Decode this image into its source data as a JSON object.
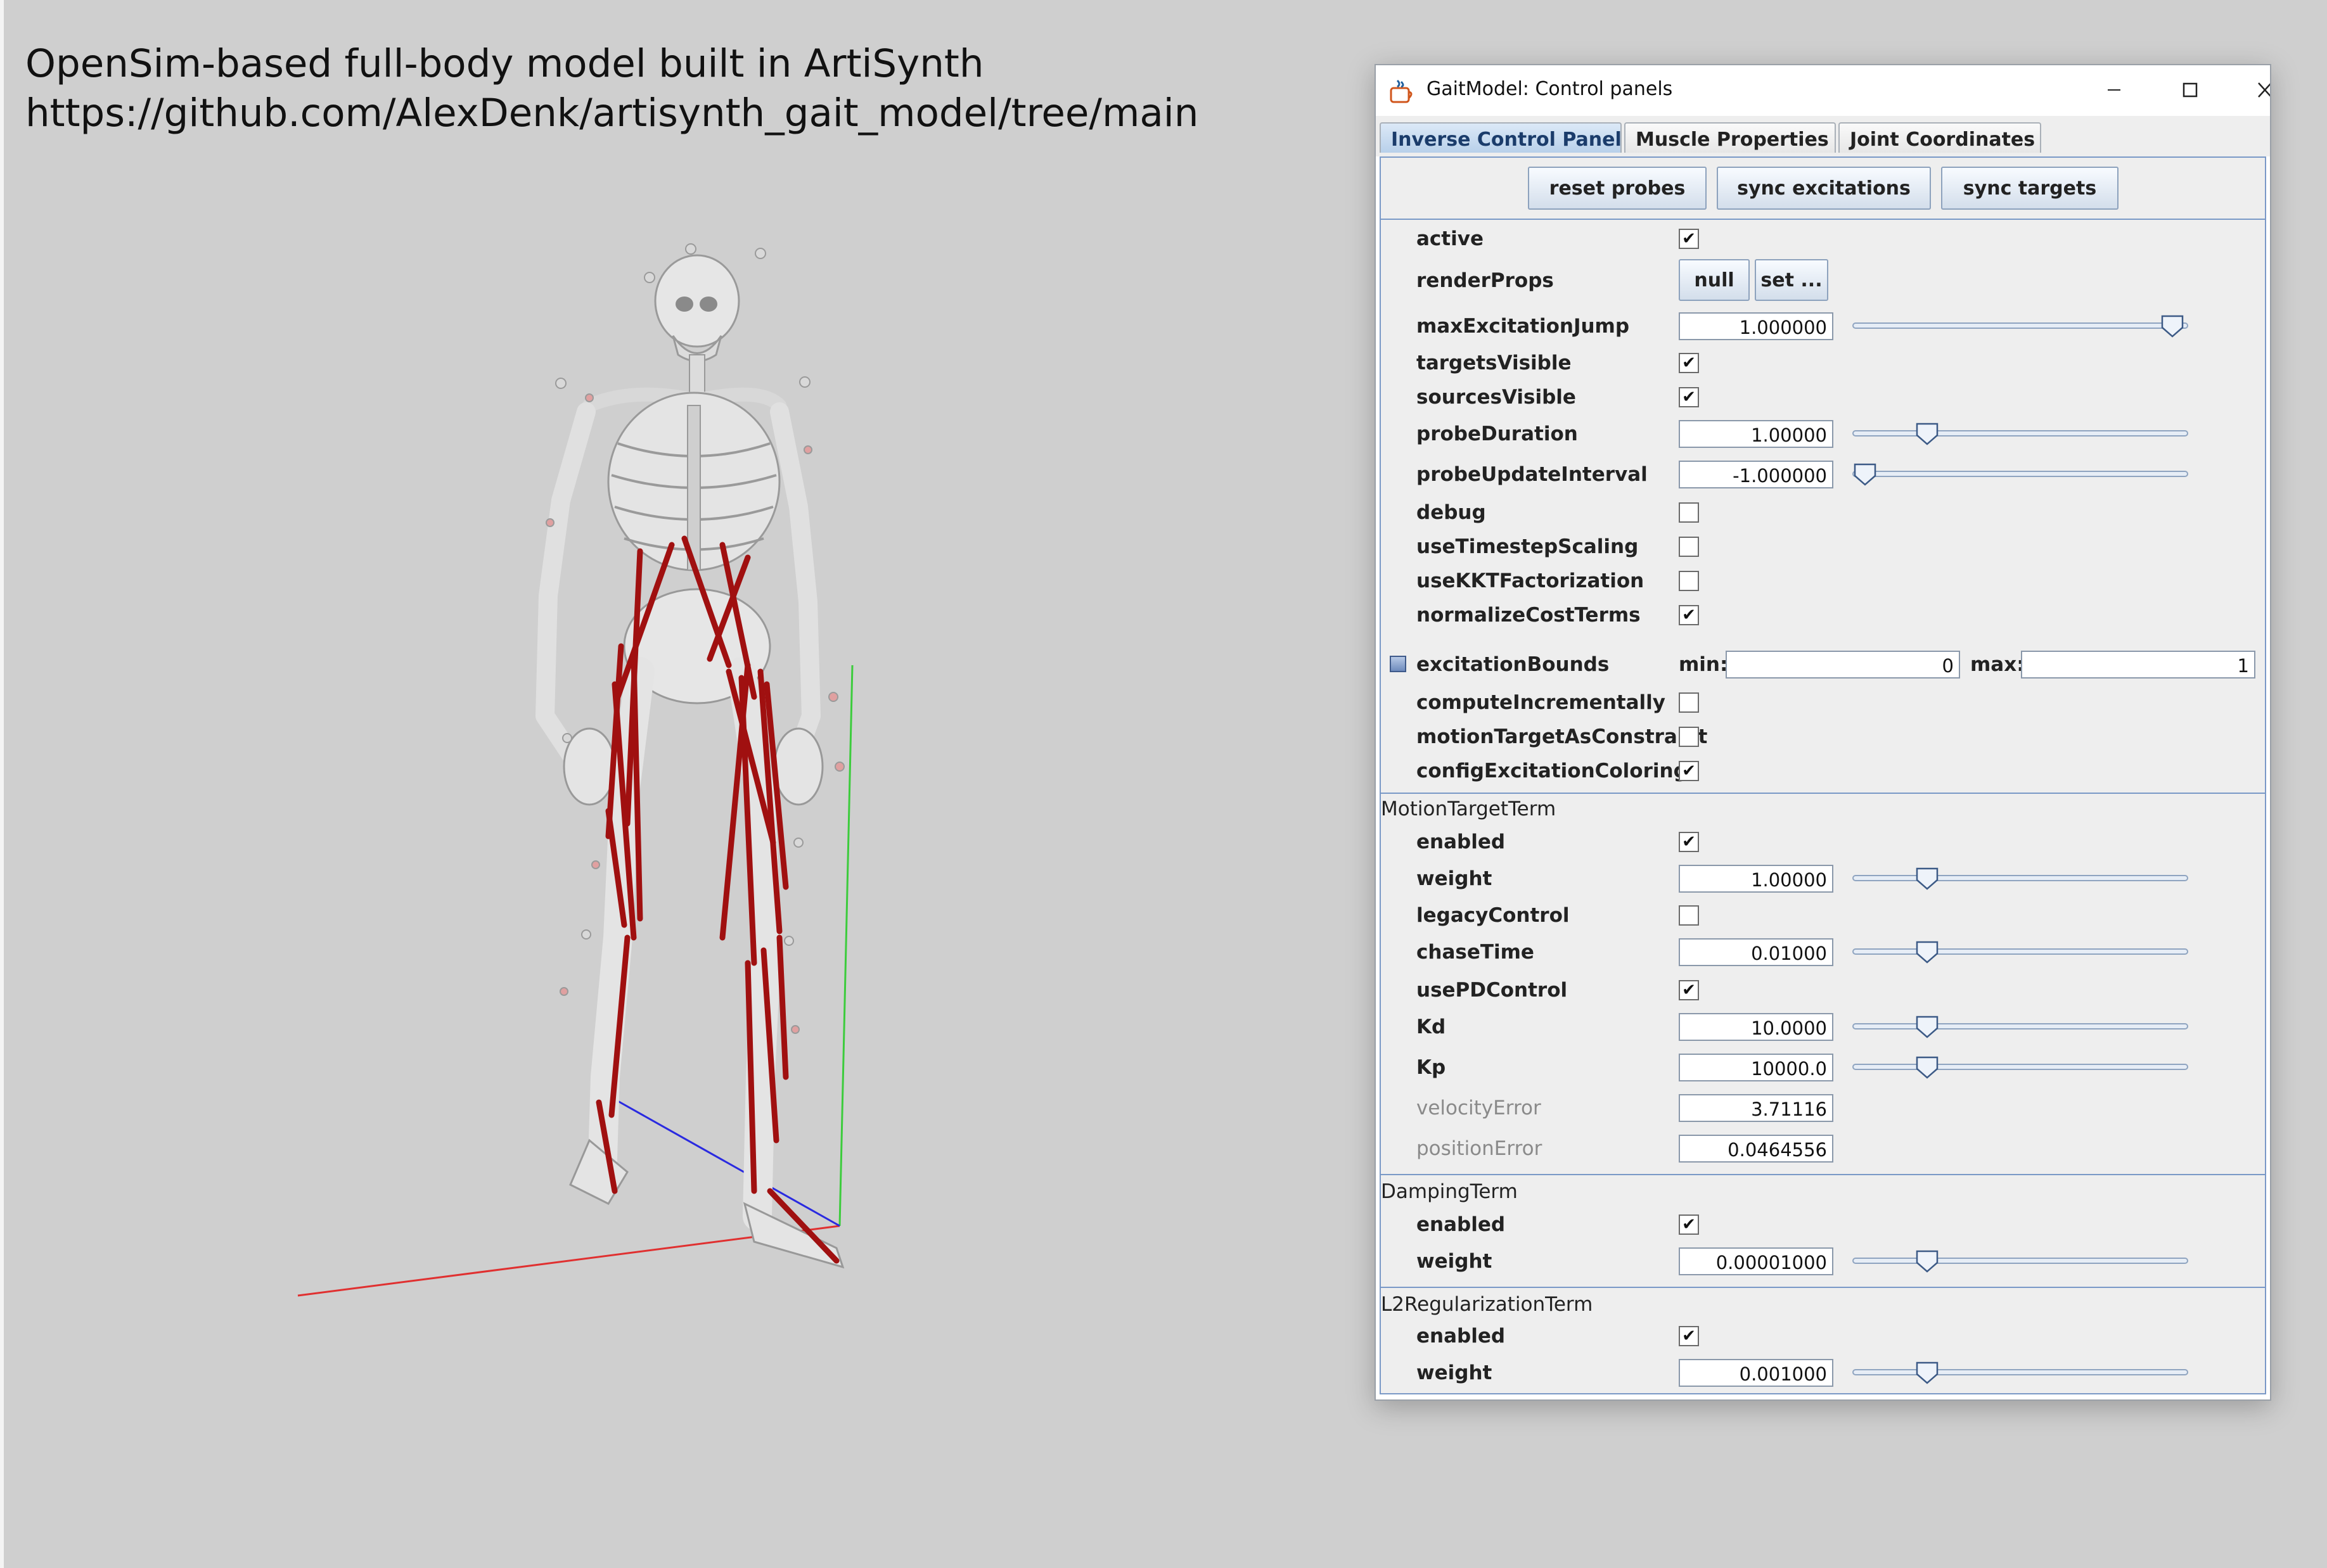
{
  "caption": {
    "line1": "OpenSim-based full-body model built in ArtiSynth",
    "line2": "https://github.com/AlexDenk/artisynth_gait_model/tree/main"
  },
  "viewer": {
    "background": "#cfcfcf",
    "axis_colors": {
      "x": "#e03030",
      "y": "#3ccc3c",
      "z": "#2a2ae0"
    },
    "bone_color": "#e8e8e8",
    "muscle_color": "#a01010"
  },
  "window": {
    "title": "GaitModel: Control panels",
    "minimize_icon": "minimize-icon",
    "maximize_icon": "maximize-icon",
    "close_icon": "close-icon"
  },
  "tabs": [
    {
      "label": "Inverse Control Panel",
      "active": true
    },
    {
      "label": "Muscle Properties",
      "active": false
    },
    {
      "label": "Joint Coordinates",
      "active": false
    }
  ],
  "buttons": {
    "reset_probes": "reset probes",
    "sync_excitations": "sync excitations",
    "sync_targets": "sync targets",
    "null": "null",
    "set": "set ..."
  },
  "properties": {
    "active": {
      "label": "active",
      "checked": true
    },
    "renderProps": {
      "label": "renderProps"
    },
    "maxExcitationJump": {
      "label": "maxExcitationJump",
      "value": "1.000000",
      "slider": 0.99
    },
    "targetsVisible": {
      "label": "targetsVisible",
      "checked": true
    },
    "sourcesVisible": {
      "label": "sourcesVisible",
      "checked": true
    },
    "probeDuration": {
      "label": "probeDuration",
      "value": "1.00000",
      "slider": 0.2
    },
    "probeUpdateInterval": {
      "label": "probeUpdateInterval",
      "value": "-1.000000",
      "slider": 0.0
    },
    "debug": {
      "label": "debug",
      "checked": false
    },
    "useTimestepScaling": {
      "label": "useTimestepScaling",
      "checked": false
    },
    "useKKTFactorization": {
      "label": "useKKTFactorization",
      "checked": false
    },
    "normalizeCostTerms": {
      "label": "normalizeCostTerms",
      "checked": true
    },
    "excitationBounds": {
      "label": "excitationBounds",
      "min_label": "min:",
      "min": "0",
      "max_label": "max:",
      "max": "1"
    },
    "computeIncrementally": {
      "label": "computeIncrementally",
      "checked": false
    },
    "motionTargetAsConstraint": {
      "label": "motionTargetAsConstraint",
      "checked": false
    },
    "configExcitationColoring": {
      "label": "configExcitationColoring",
      "checked": true
    }
  },
  "motionTargetTerm": {
    "header": "MotionTargetTerm",
    "enabled": {
      "label": "enabled",
      "checked": true
    },
    "weight": {
      "label": "weight",
      "value": "1.00000",
      "slider": 0.2
    },
    "legacyControl": {
      "label": "legacyControl",
      "checked": false
    },
    "chaseTime": {
      "label": "chaseTime",
      "value": "0.01000",
      "slider": 0.2
    },
    "usePDControl": {
      "label": "usePDControl",
      "checked": true
    },
    "Kd": {
      "label": "Kd",
      "value": "10.0000",
      "slider": 0.2
    },
    "Kp": {
      "label": "Kp",
      "value": "10000.0",
      "slider": 0.2
    },
    "velocityError": {
      "label": "velocityError",
      "value": "3.71116"
    },
    "positionError": {
      "label": "positionError",
      "value": "0.0464556"
    }
  },
  "dampingTerm": {
    "header": "DampingTerm",
    "enabled": {
      "label": "enabled",
      "checked": true
    },
    "weight": {
      "label": "weight",
      "value": "0.00001000",
      "slider": 0.2
    }
  },
  "l2RegularizationTerm": {
    "header": "L2RegularizationTerm",
    "enabled": {
      "label": "enabled",
      "checked": true
    },
    "weight": {
      "label": "weight",
      "value": "0.001000",
      "slider": 0.2
    }
  }
}
